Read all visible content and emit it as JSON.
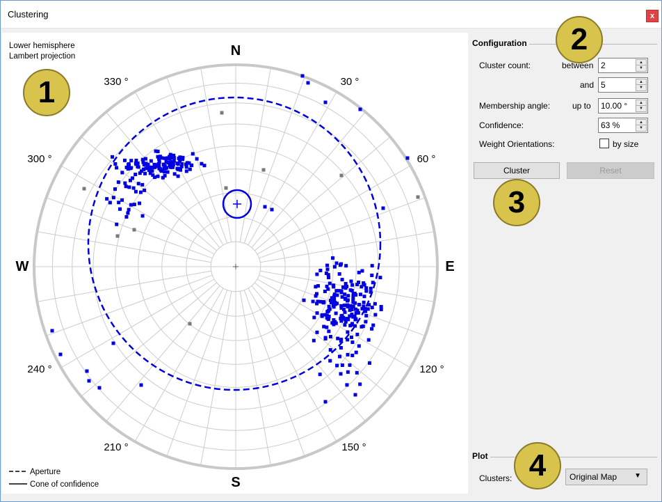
{
  "window": {
    "title": "Clustering",
    "close_label": "x"
  },
  "plot": {
    "projection_line1": "Lower hemisphere",
    "projection_line2": "Lambert projection",
    "compass": {
      "n": "N",
      "s": "S",
      "e": "E",
      "w": "W"
    },
    "degree_labels": [
      "330 °",
      "30 °",
      "300 °",
      "60 °",
      "240 °",
      "120 °",
      "210 °",
      "150 °"
    ],
    "legend": {
      "aperture": "Aperture",
      "cone": "Cone of confidence"
    },
    "colors": {
      "points": "#0000e0",
      "outliers": "#7a7a7a",
      "grid": "#cccccc",
      "primitive": "#c8c8c8"
    }
  },
  "configuration": {
    "title": "Configuration",
    "cluster_count_label": "Cluster count:",
    "between_label": "between",
    "between_value": "2",
    "and_label": "and",
    "and_value": "5",
    "membership_label": "Membership angle:",
    "upto_label": "up to",
    "membership_value": "10.00 °",
    "confidence_label": "Confidence:",
    "confidence_value": "63 %",
    "weight_label": "Weight Orientations:",
    "by_size_label": "by size",
    "by_size_checked": false,
    "cluster_button": "Cluster",
    "reset_button": "Reset"
  },
  "plot_settings": {
    "title": "Plot",
    "clusters_label": "Clusters:",
    "clusters_value": "Original Map"
  },
  "badges": [
    "1",
    "2",
    "3",
    "4"
  ]
}
